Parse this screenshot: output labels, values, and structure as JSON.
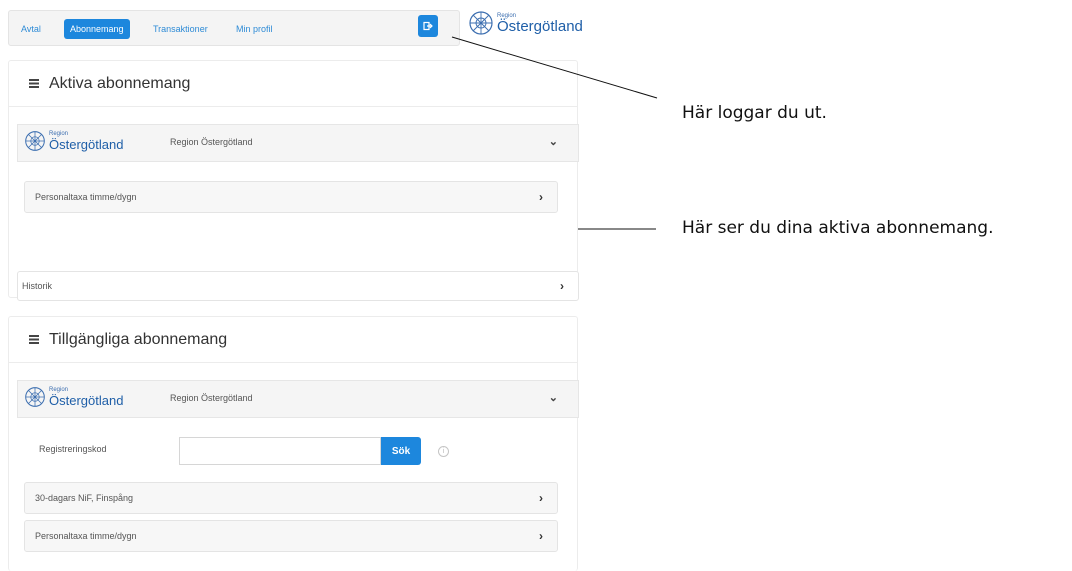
{
  "nav": {
    "tabs": [
      {
        "label": "Avtal",
        "active": false
      },
      {
        "label": "Abonnemang",
        "active": true
      },
      {
        "label": "Transaktioner",
        "active": false
      },
      {
        "label": "Min profil",
        "active": false
      }
    ],
    "logout_icon": "logout-icon"
  },
  "logo": {
    "small": "Region",
    "big": "Östergötland"
  },
  "active_panel": {
    "title": "Aktiva abonnemang",
    "org_name": "Region Östergötland",
    "items": [
      "Personaltaxa timme/dygn"
    ],
    "history_label": "Historik"
  },
  "available_panel": {
    "title": "Tillgängliga abonnemang",
    "org_name": "Region Östergötland",
    "reg_label": "Registreringskod",
    "reg_value": "",
    "search_label": "Sök",
    "info_icon": "info-icon",
    "items": [
      "30-dagars NiF, Finspång",
      "Personaltaxa timme/dygn"
    ]
  },
  "annotations": {
    "logout_note": "Här loggar du ut.",
    "active_note": "Här ser du dina aktiva abonnemang."
  },
  "colors": {
    "accent": "#1d87dd",
    "logo": "#1f5fa8"
  }
}
